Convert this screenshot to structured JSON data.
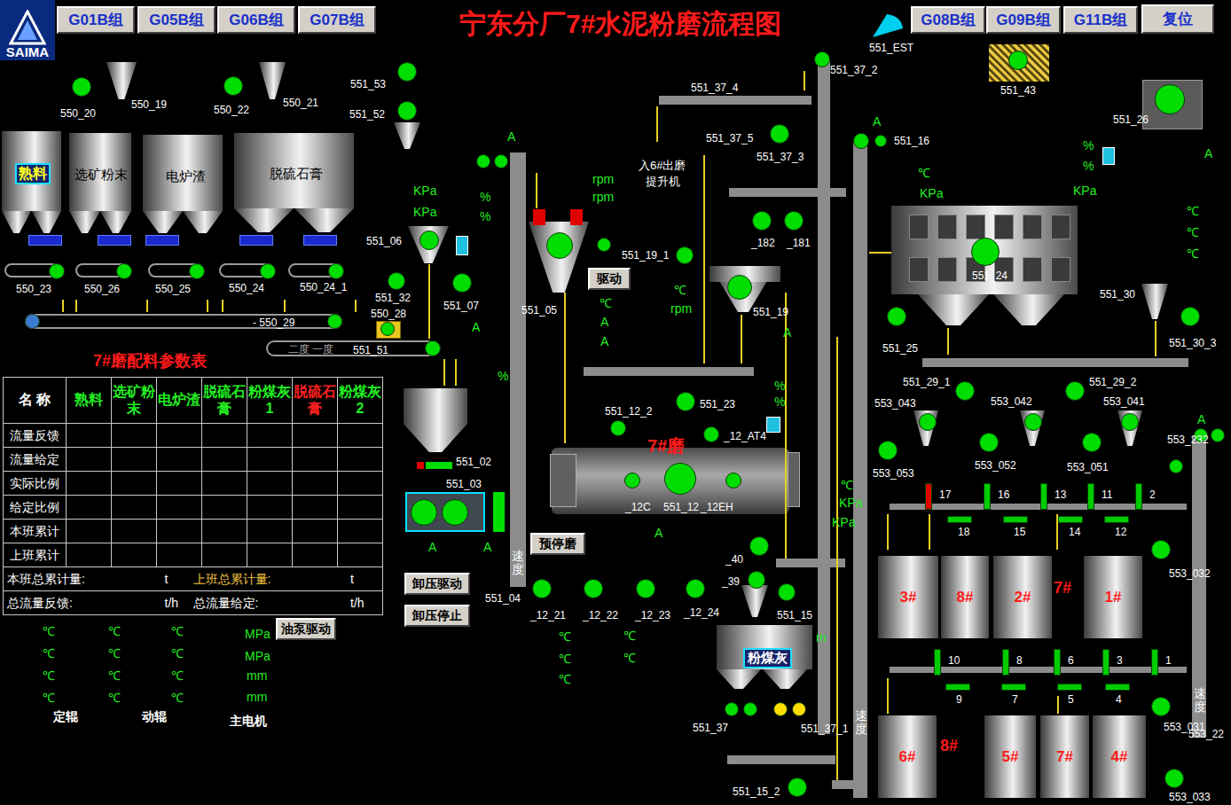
{
  "logo": "SAIMA",
  "title": "宁东分厂7#水泥粉磨流程图",
  "group_buttons_left": [
    "G01B组",
    "G05B组",
    "G06B组",
    "G07B组"
  ],
  "group_buttons_right": [
    "G08B组",
    "G09B组",
    "G11B组"
  ],
  "reset_button": "复位",
  "silos": [
    {
      "label": "熟料",
      "highlighted": true
    },
    {
      "label": "选矿粉末",
      "highlighted": false
    },
    {
      "label": "电炉渣",
      "highlighted": false
    },
    {
      "label": "脱硫石膏",
      "highlighted": false
    }
  ],
  "tags": [
    "550_20",
    "550_19",
    "550_22",
    "550_21",
    "551_53",
    "551_52",
    "551_EST",
    "551_43",
    "551_37_2",
    "551_37_4",
    "551_37_5",
    "551_37_3",
    "551_16",
    "551_26",
    "550_23",
    "550_26",
    "550_25",
    "550_24",
    "550_24_1",
    "551_06",
    "551_32",
    "551_07",
    "550_28",
    "- 550_29",
    "551_51",
    "551_05",
    "551_19_1",
    "_182",
    "_181",
    "551_19",
    "551_24",
    "551_30",
    "551_30_3",
    "551_25",
    "551_29_1",
    "551_29_2",
    "553_043",
    "553_042",
    "553_041",
    "553_232",
    "553_053",
    "553_052",
    "553_051",
    "551_12_2",
    "551_23",
    "_12_AT4",
    "551_02",
    "551_03",
    "_12C",
    "551_12",
    "_12EH",
    "551_04",
    "_12_21",
    "_12_22",
    "_12_23",
    "_12_24",
    "_40",
    "_39",
    "551_15",
    "553_032",
    "551_37",
    "551_37_1",
    "551_15_2",
    "553_031",
    "553_22",
    "553_033"
  ],
  "units": [
    "A",
    "%",
    "%",
    "KPa",
    "KPa",
    "A",
    "%",
    "rpm",
    "rpm",
    "℃",
    "A",
    "A",
    "℃",
    "rpm",
    "A",
    "%",
    "%",
    "A",
    "A",
    "A",
    "A",
    "℃",
    "KPa",
    "%",
    "%",
    "KPa",
    "A",
    "℃",
    "℃",
    "℃",
    "A",
    "℃",
    "KPa",
    "KPa",
    "m",
    "℃",
    "℃",
    "℃",
    "℃",
    "℃"
  ],
  "speed_labels": [
    "速度",
    "速度",
    "速度"
  ],
  "notes": [
    "入6#出磨",
    "提升机"
  ],
  "conveyor_marks": "二度 一度",
  "mill_label": "7#磨",
  "coal_bin_label": "粉煤灰",
  "buttons": [
    "驱动",
    "预停磨",
    "卸压驱动",
    "卸压停止",
    "油泵驱动"
  ],
  "ratio_table": {
    "title": "7#磨配料参数表",
    "columns": [
      {
        "label": "名 称",
        "color": "#ffffff"
      },
      {
        "label": "熟料",
        "color": "#22ee22"
      },
      {
        "label": "选矿粉末",
        "color": "#22ee22"
      },
      {
        "label": "电炉渣",
        "color": "#22ee22"
      },
      {
        "label": "脱硫石膏",
        "color": "#22ee22"
      },
      {
        "label": "粉煤灰1",
        "color": "#22ee22"
      },
      {
        "label": "脱硫石膏",
        "color": "#ff2020"
      },
      {
        "label": "粉煤灰2",
        "color": "#22ee22"
      }
    ],
    "rows": [
      "流量反馈",
      "流量给定",
      "实际比例",
      "给定比例",
      "本班累计",
      "上班累计"
    ],
    "totals": [
      {
        "label": "本班总累计量:",
        "unit": "t",
        "color": "#ffffff"
      },
      {
        "label": "上班总累计量:",
        "unit": "t",
        "color": "#f0c040"
      },
      {
        "label": "总流量反馈:",
        "unit": "t/h",
        "color": "#ffffff"
      },
      {
        "label": "总流量给定:",
        "unit": "t/h",
        "color": "#ffffff"
      }
    ]
  },
  "gauges": {
    "units": [
      "℃",
      "℃",
      "℃",
      "℃",
      "℃",
      "℃",
      "℃",
      "℃",
      "℃",
      "℃",
      "℃",
      "℃",
      "MPa",
      "MPa",
      "mm",
      "mm"
    ],
    "labels": [
      "定辊",
      "动辊",
      "主电机"
    ]
  },
  "tanks": [
    {
      "label": "3#"
    },
    {
      "label": "8#"
    },
    {
      "label": "2#"
    },
    {
      "label": "1#"
    },
    {
      "label": "6#"
    },
    {
      "label": "5#"
    },
    {
      "label": "7#"
    },
    {
      "label": "4#"
    }
  ],
  "tank_marks": [
    "7#",
    "8#"
  ],
  "gates": [
    {
      "number": "17",
      "kind": "vertical",
      "color": "#e00000"
    },
    {
      "number": "16",
      "kind": "vertical",
      "color": "#00cc00"
    },
    {
      "number": "13",
      "kind": "vertical",
      "color": "#00cc00"
    },
    {
      "number": "11",
      "kind": "vertical",
      "color": "#00cc00"
    },
    {
      "number": "2",
      "kind": "vertical",
      "color": "#00cc00"
    },
    {
      "number": "18",
      "kind": "horizontal",
      "color": "#00cc00"
    },
    {
      "number": "15",
      "kind": "horizontal",
      "color": "#00cc00"
    },
    {
      "number": "14",
      "kind": "horizontal",
      "color": "#00cc00"
    },
    {
      "number": "12",
      "kind": "horizontal",
      "color": "#00cc00"
    },
    {
      "number": "10",
      "kind": "vertical",
      "color": "#00cc00"
    },
    {
      "number": "8",
      "kind": "vertical",
      "color": "#00cc00"
    },
    {
      "number": "6",
      "kind": "vertical",
      "color": "#00cc00"
    },
    {
      "number": "3",
      "kind": "vertical",
      "color": "#00cc00"
    },
    {
      "number": "1",
      "kind": "vertical",
      "color": "#00cc00"
    },
    {
      "number": "9",
      "kind": "horizontal",
      "color": "#00cc00"
    },
    {
      "number": "7",
      "kind": "horizontal",
      "color": "#00cc00"
    },
    {
      "number": "5",
      "kind": "horizontal",
      "color": "#00cc00"
    },
    {
      "number": "4",
      "kind": "horizontal",
      "color": "#00cc00"
    }
  ],
  "motors": [
    {
      "color": "#00dd00"
    },
    {
      "color": "#00dd00"
    },
    {
      "color": "#00dd00"
    },
    {
      "color": "#00dd00"
    },
    {
      "color": "#00dd00"
    },
    {
      "color": "#00dd00"
    },
    {
      "color": "#00dd00"
    },
    {
      "color": "#00dd00"
    },
    {
      "color": "#00dd00"
    },
    {
      "color": "#00dd00"
    },
    {
      "color": "#00dd00"
    },
    {
      "color": "#00dd00"
    },
    {
      "color": "#00dd00"
    },
    {
      "color": "#00dd00"
    },
    {
      "color": "#00dd00"
    },
    {
      "color": "#00dd00"
    },
    {
      "color": "#00dd00"
    },
    {
      "color": "#00dd00"
    },
    {
      "color": "#00dd00"
    },
    {
      "color": "#00dd00"
    },
    {
      "color": "#00dd00"
    },
    {
      "color": "#00dd00"
    },
    {
      "color": "#00dd00"
    },
    {
      "color": "#00dd00"
    },
    {
      "color": "#00dd00"
    },
    {
      "color": "#00dd00"
    },
    {
      "color": "#00dd00"
    },
    {
      "color": "#00dd00"
    },
    {
      "color": "#00dd00"
    },
    {
      "color": "#00dd00"
    },
    {
      "color": "#00dd00"
    },
    {
      "color": "#00dd00"
    },
    {
      "color": "#00dd00"
    },
    {
      "color": "#00dd00"
    },
    {
      "color": "#00dd00"
    },
    {
      "color": "#00dd00"
    },
    {
      "color": "#00dd00"
    },
    {
      "color": "#00dd00"
    },
    {
      "color": "#00dd00"
    },
    {
      "color": "#00dd00"
    },
    {
      "color": "#00dd00"
    },
    {
      "color": "#00dd00"
    },
    {
      "color": "#00dd00"
    },
    {
      "color": "#00dd00"
    },
    {
      "color": "#00dd00"
    },
    {
      "color": "#00dd00"
    },
    {
      "color": "#00dd00"
    },
    {
      "color": "#00dd00"
    },
    {
      "color": "#00dd00"
    },
    {
      "color": "#00dd00"
    },
    {
      "color": "#00dd00"
    },
    {
      "color": "#00dd00"
    },
    {
      "color": "#00dd00"
    },
    {
      "color": "#00dd00"
    },
    {
      "color": "#00dd00"
    },
    {
      "color": "#00dd00"
    },
    {
      "color": "#00dd00"
    },
    {
      "color": "#00dd00"
    },
    {
      "color": "#ffdd00"
    },
    {
      "color": "#ffdd00"
    },
    {
      "color": "#00dd00"
    },
    {
      "color": "#00dd00"
    },
    {
      "color": "#00dd00"
    },
    {
      "color": "#00dd00"
    },
    {
      "color": "#00dd00"
    },
    {
      "color": "#00dd00"
    },
    {
      "color": "#3a7ad0"
    }
  ]
}
